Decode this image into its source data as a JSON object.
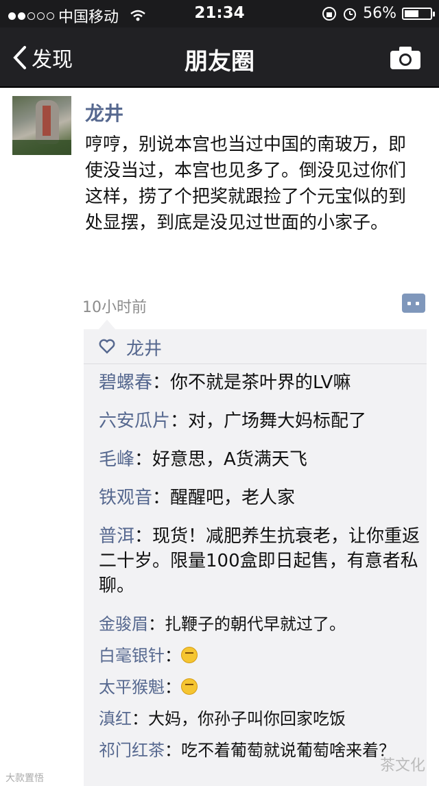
{
  "status_bar": {
    "carrier": "中国移动",
    "time": "21:34",
    "battery": "56%",
    "battery_level": 0.56
  },
  "nav": {
    "back_label": "发现",
    "title": "朋友圈",
    "camera_icon": "camera-icon"
  },
  "post": {
    "author": "龙井",
    "text": "哼哼，别说本宫也当过中国的南玻万，即使没当过，本宫也见多了。倒没见过你们这样，捞了个把奖就跟捡了个元宝似的到处显摆，到底是没见过世面的小家子。",
    "time_ago": "10小时前"
  },
  "likes": {
    "names": "龙井"
  },
  "comments": [
    {
      "who": "碧螺春",
      "sep": "：",
      "text": "你不就是茶叶界的LV嘛"
    },
    {
      "who": "六安瓜片",
      "sep": "：",
      "text": "对，广场舞大妈标配了"
    },
    {
      "who": "毛峰",
      "sep": "：",
      "text": "好意思，A货满天飞"
    },
    {
      "who": "铁观音",
      "sep": "：",
      "text": "醒醒吧，老人家"
    },
    {
      "who": "普洱",
      "sep": "：",
      "text": "现货！减肥养生抗衰老，让你重返二十岁。限量100盒即日起售，有意者私聊。"
    },
    {
      "who": "金骏眉",
      "sep": "：",
      "text": "扎鞭子的朝代早就过了。"
    },
    {
      "who": "白毫银针",
      "sep": "：",
      "text": ""
    },
    {
      "who": "太平猴魁",
      "sep": "：",
      "text": ""
    },
    {
      "who": "滇红",
      "sep": "：",
      "text": "大妈，你孙子叫你回家吃饭"
    },
    {
      "who": "祁门红茶",
      "sep": "：",
      "text": "吃不着葡萄就说葡萄啥来着？"
    }
  ],
  "watermarks": {
    "left": "大款置悟",
    "right": "茶文化"
  },
  "colors": {
    "link": "#56688f",
    "navbar": "#212124",
    "panel": "#f2f2f4"
  }
}
